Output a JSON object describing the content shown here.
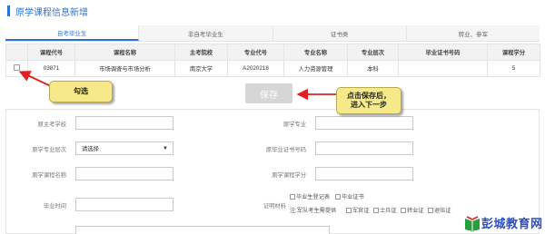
{
  "page": {
    "title": "原学课程信息新增"
  },
  "tabs": [
    {
      "label": "自考毕业生",
      "active": true
    },
    {
      "label": "非自考毕业生",
      "active": false
    },
    {
      "label": "证书类",
      "active": false
    },
    {
      "label": "转业、参军",
      "active": false
    }
  ],
  "table": {
    "headers": [
      "",
      "课程代号",
      "课程名称",
      "主考院校",
      "专业代号",
      "专业名称",
      "专业层次",
      "毕业证书号码",
      "课程学分"
    ],
    "rows": [
      {
        "checked": false,
        "course_code": "03871",
        "course_name": "市场调查与市场分析",
        "school": "南京大学",
        "major_code": "A2020218",
        "major_name": "人力资源管理",
        "level": "本科",
        "cert_no": "",
        "credit": "5"
      }
    ]
  },
  "annotations": {
    "select_hint": "勾选",
    "save_hint_line1": "点击保存后，",
    "save_hint_line2": "进入下一步"
  },
  "save_button": {
    "label": "保存",
    "enabled": false
  },
  "form": {
    "orig_school_label": "原主考学校",
    "orig_major_label": "原学专业",
    "orig_level_label": "原学专业层次",
    "orig_level_value": "请选择",
    "orig_cert_label": "原毕业证书号码",
    "orig_course_label": "原学课程名称",
    "orig_credit_label": "原学课程学分",
    "grad_time_label": "毕业时间",
    "proof_label": "证明材料",
    "proof_options_row1": [
      "毕业生登记表",
      "毕业证书"
    ],
    "proof_row2_prefix": "注:军队考生需提供",
    "proof_options_row2": [
      "军官证",
      "士兵证",
      "转业证",
      "退伍证"
    ]
  },
  "colors": {
    "accent": "#2d73d6",
    "callout": "#f5e98a",
    "arrow": "#e02020"
  },
  "logo": {
    "text": "彭城教育网",
    "icon": "book-icon"
  }
}
